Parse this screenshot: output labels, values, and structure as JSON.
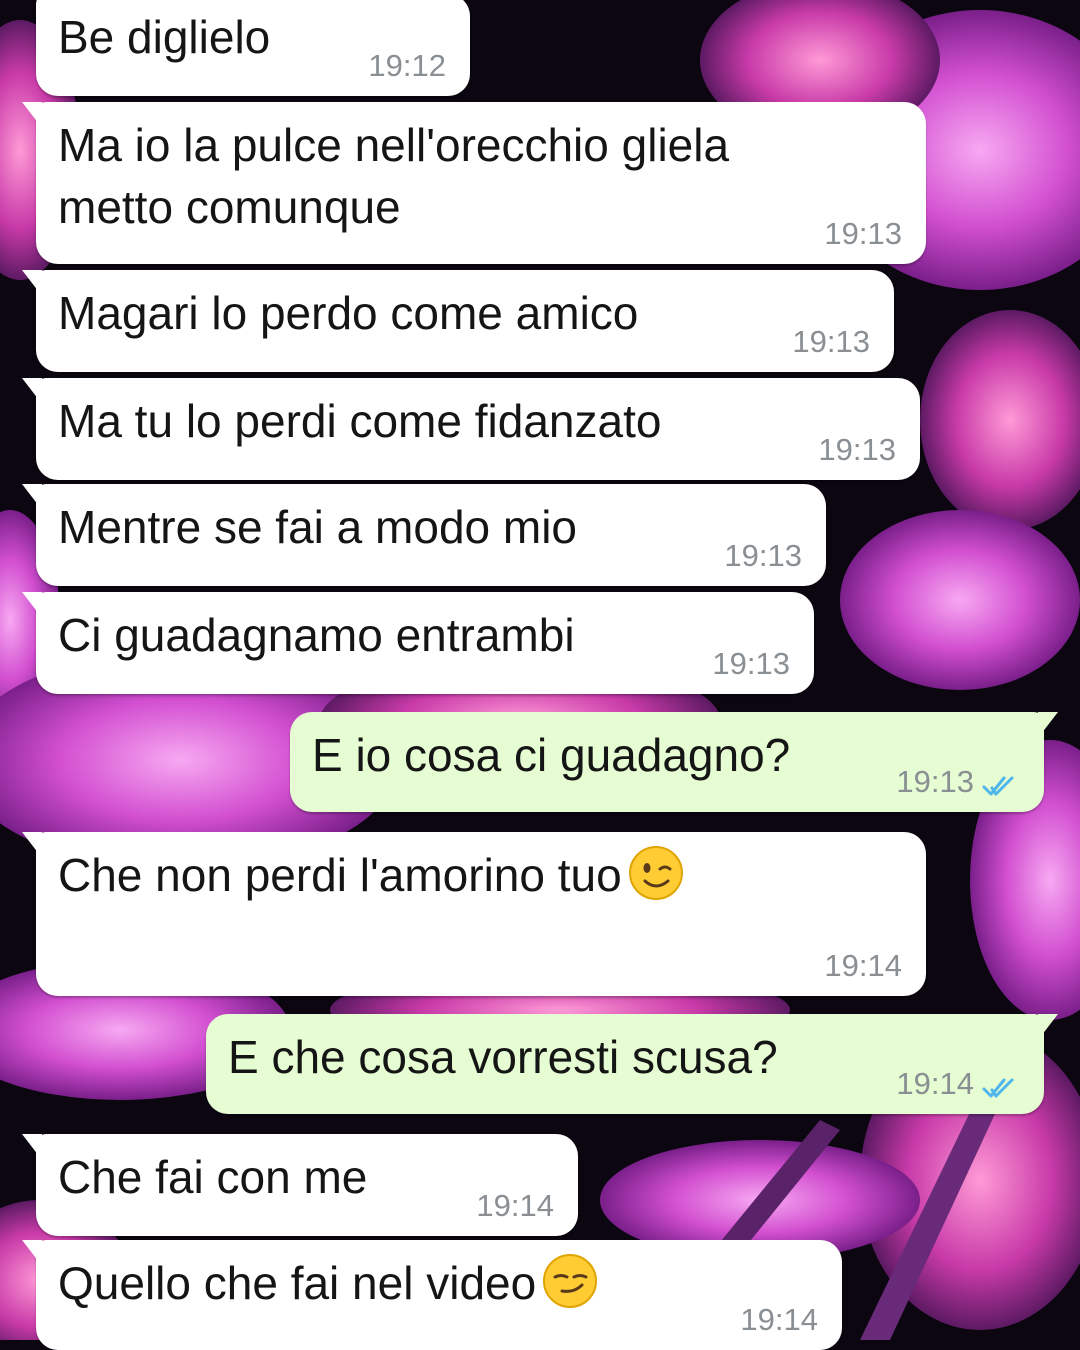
{
  "chat": {
    "messages": [
      {
        "dir": "in",
        "text": "Be diglielo",
        "time": "19:12"
      },
      {
        "dir": "in",
        "text": "Ma io la pulce nell'orecchio gliela\nmetto comunque",
        "time": "19:13"
      },
      {
        "dir": "in",
        "text": "Magari lo perdo come amico",
        "time": "19:13"
      },
      {
        "dir": "in",
        "text": "Ma tu lo perdi come fidanzato",
        "time": "19:13"
      },
      {
        "dir": "in",
        "text": "Mentre se fai a modo mio",
        "time": "19:13"
      },
      {
        "dir": "in",
        "text": "Ci guadagnamo entrambi",
        "time": "19:13"
      },
      {
        "dir": "out",
        "text": "E io cosa ci guadagno?",
        "time": "19:13",
        "status": "read"
      },
      {
        "dir": "in",
        "text": "Che non perdi l'amorino tuo",
        "emoji": "winking-face",
        "time": "19:14"
      },
      {
        "dir": "out",
        "text": "E che cosa vorresti scusa?",
        "time": "19:14",
        "status": "read"
      },
      {
        "dir": "in",
        "text": "Che fai con me",
        "time": "19:14"
      },
      {
        "dir": "in",
        "text": "Quello che fai nel video",
        "emoji": "smirking-face",
        "time": "19:14"
      }
    ]
  },
  "colors": {
    "incoming_bubble": "#ffffff",
    "outgoing_bubble": "#e6fdd3",
    "read_ticks": "#4fb6ec",
    "timestamp": "#8a8f93"
  }
}
